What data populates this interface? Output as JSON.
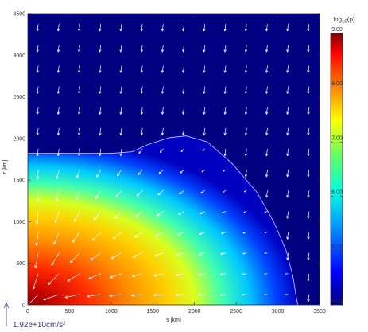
{
  "chart_data": {
    "type": "heatmap",
    "xlabel": "s [km]",
    "ylabel": "z [km]",
    "xlim": [
      0,
      3500
    ],
    "ylim": [
      0,
      3500
    ],
    "x_ticks": [
      "0",
      "500",
      "1000",
      "1500",
      "2000",
      "2500",
      "3000",
      "3500"
    ],
    "y_ticks": [
      "0",
      "500",
      "1000",
      "1500",
      "2000",
      "2500",
      "3000",
      "3500"
    ],
    "colorbar": {
      "label_prefix": "log",
      "label_sub": "10",
      "label_suffix": "(ρ)",
      "range": [
        4.0,
        9.0
      ],
      "tick_labels": [
        "4.00",
        "5.00",
        "6.00",
        "7.00",
        "8.00",
        "9.00"
      ],
      "colormap": "rainbow"
    },
    "field": {
      "description_of_values": "density log10(rho) decreasing outward from origin",
      "center_value": 9.0,
      "boundary_value": 4.0,
      "boundary_contour_km": [
        [
          0,
          1820
        ],
        [
          500,
          1820
        ],
        [
          1000,
          1820
        ],
        [
          1250,
          1840
        ],
        [
          1450,
          1930
        ],
        [
          1700,
          2010
        ],
        [
          1900,
          2030
        ],
        [
          2150,
          1960
        ],
        [
          2450,
          1700
        ],
        [
          2750,
          1350
        ],
        [
          2950,
          1000
        ],
        [
          3100,
          650
        ],
        [
          3180,
          350
        ],
        [
          3220,
          100
        ],
        [
          3240,
          0
        ]
      ]
    },
    "vector_scale": {
      "label": "1.92e+10cm/s²"
    },
    "colors": {
      "background": "#000080",
      "arrow": "#ffffff",
      "contour": "#d0d0e0",
      "axis_text": "#2e2e2e"
    }
  }
}
